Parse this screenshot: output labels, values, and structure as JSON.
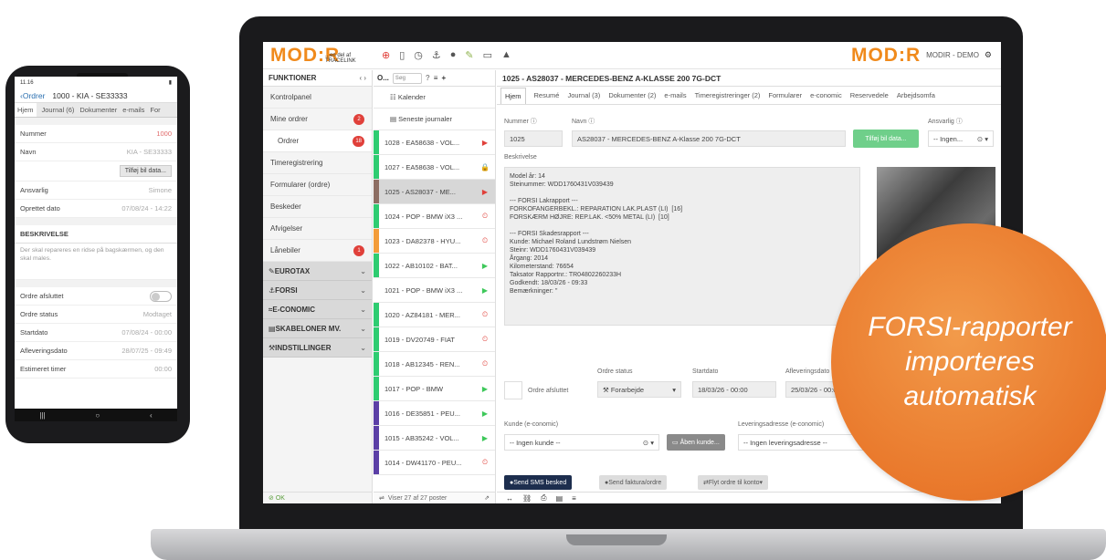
{
  "callout": {
    "lines": [
      "FORSI-rapporter",
      "importeres",
      "automatisk"
    ]
  },
  "laptop": {
    "logo": "MOD:R",
    "logo_sub": "...en del af TRACELINK",
    "logo_right": "MOD:R",
    "user": "MODIR - DEMO",
    "col1": {
      "title": "FUNKTIONER",
      "items": [
        {
          "label": "Kontrolpanel",
          "badge": ""
        },
        {
          "label": "Mine ordrer",
          "badge": "2"
        },
        {
          "label": "Ordrer",
          "badge": "18"
        },
        {
          "label": "Timeregistrering",
          "badge": ""
        },
        {
          "label": "Formularer (ordre)",
          "badge": ""
        },
        {
          "label": "Beskeder",
          "badge": ""
        },
        {
          "label": "Afvigelser",
          "badge": ""
        },
        {
          "label": "Lånebiler",
          "badge": "1"
        }
      ],
      "groups": [
        "EUROTAX",
        "FORSI",
        "E-CONOMIC",
        "SKABELONER MV.",
        "INDSTILLINGER"
      ],
      "status": "OK"
    },
    "col2": {
      "title": "O...",
      "search_placeholder": "Søg",
      "pinned": [
        "Kalender",
        "Seneste journaler"
      ],
      "orders": [
        {
          "label": "1028 - EA58638 - VOL...",
          "color": "#2ecc71",
          "status": "▶",
          "status_color": "#e0403a"
        },
        {
          "label": "1027 - EA58638 - VOL...",
          "color": "#2ecc71",
          "status": "🔒",
          "status_color": "#888"
        },
        {
          "label": "1025 - AS28037 - ME...",
          "color": "#8d6e63",
          "status": "▶",
          "status_color": "#e0403a"
        },
        {
          "label": "1024 - POP - BMW iX3 ...",
          "color": "#2ecc71",
          "status": "⏲",
          "status_color": "#e0403a"
        },
        {
          "label": "1023 - DA82378 - HYU...",
          "color": "#f39c3a",
          "status": "⏲",
          "status_color": "#e0403a"
        },
        {
          "label": "1022 - AB10102 - BAT...",
          "color": "#2ecc71",
          "status": "▶",
          "status_color": "#3ec85a"
        },
        {
          "label": "1021 - POP - BMW iX3 ...",
          "color": "#ffffff",
          "status": "▶",
          "status_color": "#3ec85a"
        },
        {
          "label": "1020 - AZ84181 - MER...",
          "color": "#2ecc71",
          "status": "⏲",
          "status_color": "#e0403a"
        },
        {
          "label": "1019 - DV20749 - FIAT",
          "color": "#2ecc71",
          "status": "⏲",
          "status_color": "#e0403a"
        },
        {
          "label": "1018 - AB12345 - REN...",
          "color": "#2ecc71",
          "status": "⏲",
          "status_color": "#e0403a"
        },
        {
          "label": "1017 - POP - BMW",
          "color": "#2ecc71",
          "status": "▶",
          "status_color": "#3ec85a"
        },
        {
          "label": "1016 - DE35851 - PEU...",
          "color": "#5b3fa6",
          "status": "▶",
          "status_color": "#3ec85a"
        },
        {
          "label": "1015 - AB35242 - VOL...",
          "color": "#5b3fa6",
          "status": "▶",
          "status_color": "#3ec85a"
        },
        {
          "label": "1014 - DW41170 - PEU...",
          "color": "#5b3fa6",
          "status": "⏲",
          "status_color": "#e0403a"
        }
      ],
      "footer": "Viser 27 af 27 poster"
    },
    "col3": {
      "title": "1025 - AS28037 - MERCEDES-BENZ A-KLASSE 200 7G-DCT",
      "tabs": [
        "Hjem",
        "Resumé",
        "Journal (3)",
        "Dokumenter (2)",
        "e-mails",
        "Timeregistreringer (2)",
        "Formularer",
        "e-conomic",
        "Reservedele",
        "Arbejdsomfa"
      ],
      "nummer_label": "Nummer",
      "nummer": "1025",
      "navn_label": "Navn",
      "navn": "AS28037 - MERCEDES-BENZ A-Klasse 200 7G-DCT",
      "tilfoj": "Tilføj bil data...",
      "ansvarlig_label": "Ansvarlig",
      "ansvarlig": "-- Ingen...",
      "beskrivelse_label": "Beskrivelse",
      "beskrivelse": "Model år: 14\nSteinummer: WDD1760431V039439\n\n--- FORSI Lakrapport ---\nFORKOFANGERBEKL.: REPARATION LAK.PLAST (LI)  [16]\nFORSKÆRM HØJRE: REP.LAK. <50% METAL (LI)  [10]\n\n--- FORSI Skadesrapport ---\nKunde: Michael Roland Lundstrøm Nielsen\nSteinr: WDD1760431V039439\nÅrgang: 2014\nKilometerstand: 76654\nTaksator Rapportnr.: TR04802260233H\nGodkendt: 18/03/26 - 09:33\nBemærkninger: ''",
      "ordre_afsluttet": "Ordre afsluttet",
      "ordre_status_label": "Ordre status",
      "ordre_status": "Forarbejde",
      "startdato_label": "Startdato",
      "startdato": "18/03/26 - 00:00",
      "afleveringsdato_label": "Afleveringsdato",
      "afleveringsdato": "25/03/26 - 00:00",
      "kunde_label": "Kunde (e-conomic)",
      "kunde": "-- Ingen kunde --",
      "aaben_kunde": "Åben kunde...",
      "levering_label": "Leveringsadresse (e-conomic)",
      "levering": "-- Ingen leveringsadresse --",
      "btn1": "Send SMS besked",
      "btn2": "Send faktura/ordre",
      "btn3": "Flyt ordre til konto"
    }
  },
  "phone": {
    "time": "11.16",
    "back": "Ordrer",
    "title": "1000 - KIA - SE33333",
    "tabs": [
      "Hjem",
      "Journal (6)",
      "Dokumenter",
      "e-mails",
      "For"
    ],
    "rows_top": [
      {
        "label": "Nummer",
        "value": "1000",
        "red": true
      },
      {
        "label": "Navn",
        "value": "KIA - SE33333",
        "red": false
      }
    ],
    "tilfoj": "Tilføj bil data...",
    "rows_mid": [
      {
        "label": "Ansvarlig",
        "value": "Simone",
        "red": false
      },
      {
        "label": "Oprettet dato",
        "value": "07/08/24 - 14:22",
        "red": false
      }
    ],
    "desc_title": "BESKRIVELSE",
    "desc": "Der skal repareres en ridse på bagskærmen, og den skal males.",
    "ordre_afsluttet": "Ordre afsluttet",
    "rows_bottom": [
      {
        "label": "Ordre status",
        "value": "Modtaget",
        "red": false
      },
      {
        "label": "Startdato",
        "value": "07/08/24 - 00:00",
        "red": false
      },
      {
        "label": "Afleveringsdato",
        "value": "28/07/25 - 09:49",
        "red": false
      },
      {
        "label": "Estimeret timer",
        "value": "00:00",
        "red": false
      }
    ]
  }
}
